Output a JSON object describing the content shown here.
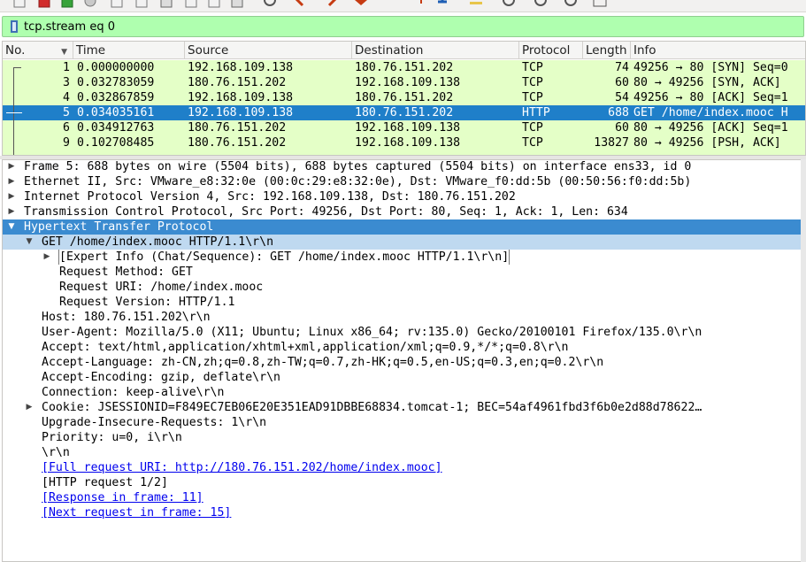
{
  "toolbar": {
    "icons": [
      "file-open-icon",
      "close-file-icon",
      "reload-file-icon",
      "options-icon",
      "save-icon",
      "capture-icon",
      "search-icon",
      "back-icon",
      "forward-icon",
      "go-to-icon",
      "jump-last-icon",
      "autoscroll-icon",
      "colorize-icon",
      "zoom-in-icon",
      "zoom-out-icon",
      "normal-size-icon",
      "resize-columns-icon"
    ],
    "accent": "#c63b12"
  },
  "filter": {
    "value": "tcp.stream eq 0",
    "background": "#afffaf"
  },
  "packet_list": {
    "columns": [
      "No.",
      "Time",
      "Source",
      "Destination",
      "Protocol",
      "Length",
      "Info"
    ],
    "rows": [
      {
        "no": "1",
        "time": "0.000000000",
        "src": "192.168.109.138",
        "dst": "180.76.151.202",
        "proto": "TCP",
        "len": "74",
        "info": "49256 → 80 [SYN] Seq=0"
      },
      {
        "no": "3",
        "time": "0.032783059",
        "src": "180.76.151.202",
        "dst": "192.168.109.138",
        "proto": "TCP",
        "len": "60",
        "info": "80 → 49256 [SYN, ACK]"
      },
      {
        "no": "4",
        "time": "0.032867859",
        "src": "192.168.109.138",
        "dst": "180.76.151.202",
        "proto": "TCP",
        "len": "54",
        "info": "49256 → 80 [ACK] Seq=1"
      },
      {
        "no": "5",
        "time": "0.034035161",
        "src": "192.168.109.138",
        "dst": "180.76.151.202",
        "proto": "HTTP",
        "len": "688",
        "info": "GET /home/index.mooc H"
      },
      {
        "no": "6",
        "time": "0.034912763",
        "src": "180.76.151.202",
        "dst": "192.168.109.138",
        "proto": "TCP",
        "len": "60",
        "info": "80 → 49256 [ACK] Seq=1"
      },
      {
        "no": "9",
        "time": "0.102708485",
        "src": "180.76.151.202",
        "dst": "192.168.109.138",
        "proto": "TCP",
        "len": "13827",
        "info": "80 → 49256 [PSH, ACK]"
      }
    ],
    "row_color": "#e4ffc7",
    "selected_color": "#1f7fc9"
  },
  "details": {
    "lines": [
      {
        "indent": 0,
        "arrow": "collapsed",
        "text": "Frame 5: 688 bytes on wire (5504 bits), 688 bytes captured (5504 bits) on interface ens33, id 0"
      },
      {
        "indent": 0,
        "arrow": "collapsed",
        "text": "Ethernet II, Src: VMware_e8:32:0e (00:0c:29:e8:32:0e), Dst: VMware_f0:dd:5b (00:50:56:f0:dd:5b)"
      },
      {
        "indent": 0,
        "arrow": "collapsed",
        "text": "Internet Protocol Version 4, Src: 192.168.109.138, Dst: 180.76.151.202"
      },
      {
        "indent": 0,
        "arrow": "collapsed",
        "text": "Transmission Control Protocol, Src Port: 49256, Dst Port: 80, Seq: 1, Ack: 1, Len: 634"
      },
      {
        "indent": 0,
        "arrow": "expanded",
        "text": "Hypertext Transfer Protocol",
        "style": "selected"
      },
      {
        "indent": 1,
        "arrow": "expanded",
        "text": "GET /home/index.mooc HTTP/1.1\\r\\n",
        "style": "subsel"
      },
      {
        "indent": 2,
        "arrow": "collapsed",
        "text": "[Expert Info (Chat/Sequence): GET /home/index.mooc HTTP/1.1\\r\\n]",
        "style": "boxed"
      },
      {
        "indent": 2,
        "arrow": "",
        "text": "Request Method: GET"
      },
      {
        "indent": 2,
        "arrow": "",
        "text": "Request URI: /home/index.mooc"
      },
      {
        "indent": 2,
        "arrow": "",
        "text": "Request Version: HTTP/1.1"
      },
      {
        "indent": 1,
        "arrow": "",
        "text": "Host: 180.76.151.202\\r\\n"
      },
      {
        "indent": 1,
        "arrow": "",
        "text": "User-Agent: Mozilla/5.0 (X11; Ubuntu; Linux x86_64; rv:135.0) Gecko/20100101 Firefox/135.0\\r\\n"
      },
      {
        "indent": 1,
        "arrow": "",
        "text": "Accept: text/html,application/xhtml+xml,application/xml;q=0.9,*/*;q=0.8\\r\\n"
      },
      {
        "indent": 1,
        "arrow": "",
        "text": "Accept-Language: zh-CN,zh;q=0.8,zh-TW;q=0.7,zh-HK;q=0.5,en-US;q=0.3,en;q=0.2\\r\\n"
      },
      {
        "indent": 1,
        "arrow": "",
        "text": "Accept-Encoding: gzip, deflate\\r\\n"
      },
      {
        "indent": 1,
        "arrow": "",
        "text": "Connection: keep-alive\\r\\n"
      },
      {
        "indent": 1,
        "arrow": "collapsed",
        "text": "Cookie: JSESSIONID=F849EC7EB06E20E351EAD91DBBE68834.tomcat-1; BEC=54af4961fbd3f6b0e2d88d78622…"
      },
      {
        "indent": 1,
        "arrow": "",
        "text": "Upgrade-Insecure-Requests: 1\\r\\n"
      },
      {
        "indent": 1,
        "arrow": "",
        "text": "Priority: u=0, i\\r\\n"
      },
      {
        "indent": 1,
        "arrow": "",
        "text": "\\r\\n"
      },
      {
        "indent": 1,
        "arrow": "",
        "text": "[Full request URI: http://180.76.151.202/home/index.mooc]",
        "style": "link"
      },
      {
        "indent": 1,
        "arrow": "",
        "text": "[HTTP request 1/2]"
      },
      {
        "indent": 1,
        "arrow": "",
        "text": "[Response in frame: 11]",
        "style": "link"
      },
      {
        "indent": 1,
        "arrow": "",
        "text": "[Next request in frame: 15]",
        "style": "link"
      }
    ],
    "selected_color": "#3b8bd0",
    "link_color": "#0000ee"
  }
}
